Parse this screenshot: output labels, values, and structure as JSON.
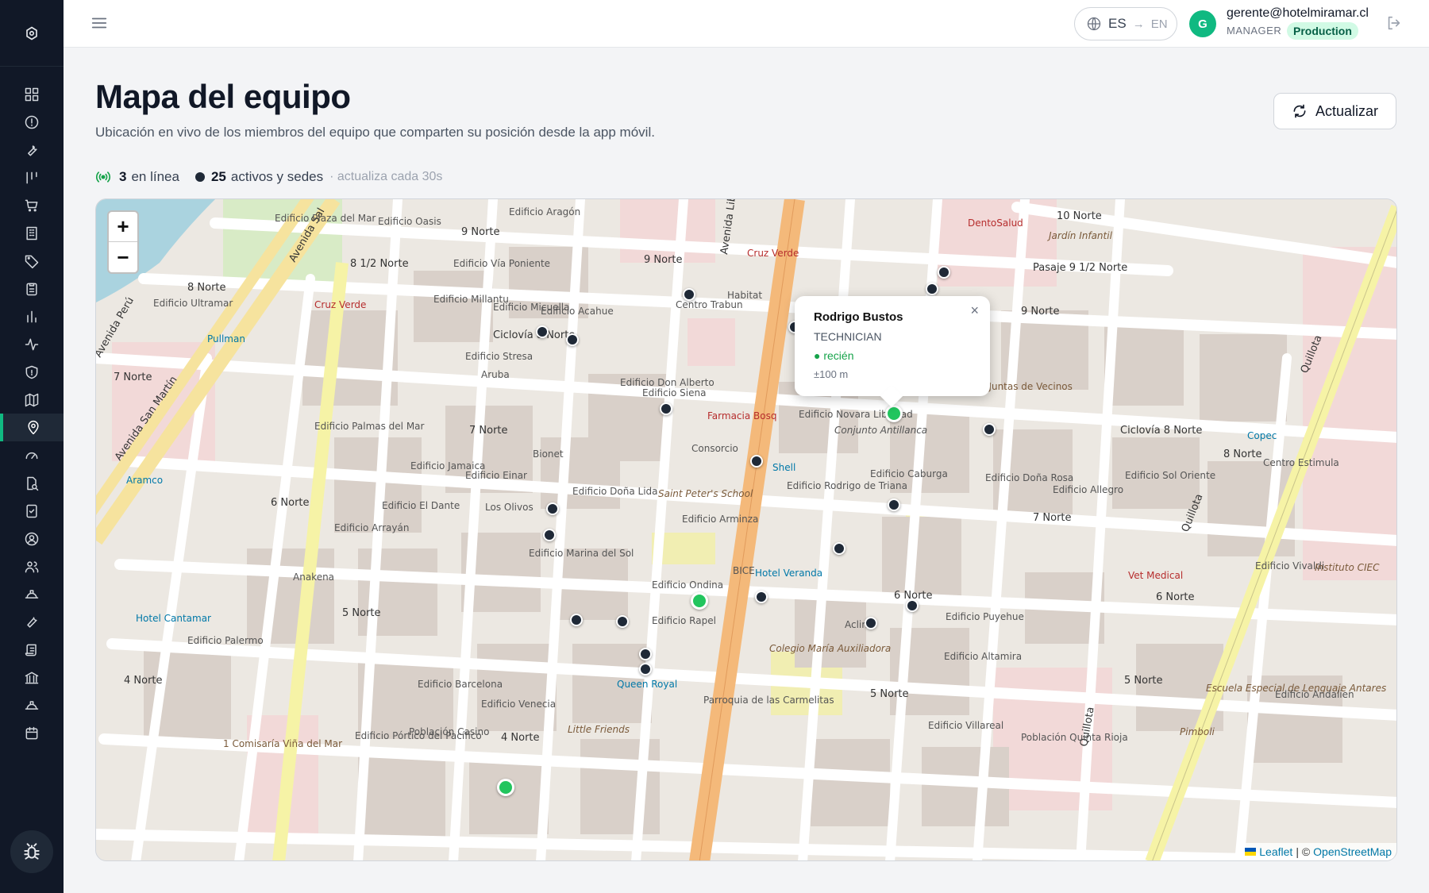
{
  "app": {
    "logo_icon": "gear-logo-icon"
  },
  "sidebar": {
    "items": [
      {
        "icon": "dashboard-icon"
      },
      {
        "icon": "alert-circle-icon"
      },
      {
        "icon": "wrench-icon"
      },
      {
        "icon": "columns-icon"
      },
      {
        "icon": "cart-icon"
      },
      {
        "icon": "building-icon"
      },
      {
        "icon": "tag-icon"
      },
      {
        "icon": "clipboard-icon"
      },
      {
        "icon": "bar-chart-icon"
      },
      {
        "icon": "activity-icon"
      },
      {
        "icon": "shield-icon"
      },
      {
        "icon": "map-icon"
      },
      {
        "icon": "location-pin-icon",
        "active": true
      },
      {
        "icon": "gauge-icon"
      },
      {
        "icon": "file-search-icon"
      },
      {
        "icon": "checklist-icon"
      },
      {
        "icon": "user-circle-icon"
      },
      {
        "icon": "users-icon"
      },
      {
        "icon": "hard-hat-icon"
      },
      {
        "icon": "tool-icon"
      },
      {
        "icon": "scroll-icon"
      },
      {
        "icon": "bank-icon"
      },
      {
        "icon": "helmet-icon"
      },
      {
        "icon": "calendar-icon"
      }
    ],
    "bug_icon": "bug-icon"
  },
  "topbar": {
    "lang_from": "ES",
    "lang_arrow": "→",
    "lang_to": "EN",
    "avatar_initial": "G",
    "user_email": "gerente@hotelmiramar.cl",
    "user_role": "MANAGER",
    "env_badge": "Production"
  },
  "page": {
    "title": "Mapa del equipo",
    "subtitle": "Ubicación en vivo de los miembros del equipo que comparten su posición desde la app móvil.",
    "refresh_label": "Actualizar",
    "stats": {
      "online_count": "3",
      "online_label": "en línea",
      "assets_count": "25",
      "assets_label": "activos y sedes",
      "refresh_note": "· actualiza cada 30s"
    }
  },
  "map": {
    "zoom_in": "+",
    "zoom_out": "−",
    "popup": {
      "name": "Rodrigo Bustos",
      "role": "TECHNICIAN",
      "status": "● recién",
      "accuracy": "±100 m",
      "close": "×"
    },
    "attribution": {
      "leaflet": "Leaflet",
      "separator": "| ©",
      "osm": "OpenStreetMap"
    },
    "labels": {
      "edificio_plaza": "Edificio Plaza del Mar",
      "edificio_oasis": "Edificio Oasis",
      "edificio_aragon": "Edificio Aragón",
      "nueve_norte": "9 Norte",
      "ocho_medio_norte": "8 1/2 Norte",
      "ocho_norte": "8 Norte",
      "edificio_via_poniente": "Edificio Vía Poniente",
      "edificio_ultramar": "Edificio Ultramar",
      "edificio_millantu": "Edificio Millantu",
      "cruz_verde": "Cruz Verde",
      "pullman": "Pullman",
      "siete_norte": "7 Norte",
      "dentosalud": "DentoSalud",
      "jardin_infantil": "Jardín Infantil",
      "diez_norte": "10 Norte",
      "pasaje": "Pasaje 9 1/2 Norte",
      "centro_trabun": "Centro Trabun",
      "habitat": "Habitat",
      "union_comunal": "Unión Comunal de Juntas de Vecinos",
      "edificio_novara": "Edificio Novara Libertad",
      "conjunto_antillanca": "Conjunto Antillanca",
      "farmacia": "Farmacia Bosq",
      "consorcio": "Consorcio",
      "edificio_caburga": "Edificio Caburga",
      "shell": "Shell",
      "edificio_rodrigo_triana": "Edificio Rodrigo de Triana",
      "saint_peters": "Saint Peter's School",
      "edificio_arminza": "Edificio Arminza",
      "hotel_veranda": "Hotel Veranda",
      "bice": "BICE",
      "colegio": "Colegio María Auxiliadora",
      "edificio_puyehue": "Edificio Puyehue",
      "edificio_altamira": "Edificio Altamira",
      "cinco_norte": "5 Norte",
      "seis_norte": "6 Norte",
      "cuatro_norte": "4 Norte",
      "parroquia": "Parroquia de las Carmelitas",
      "queen_royal": "Queen Royal",
      "little_friends": "Little Friends",
      "poblacion_casino": "Población Casino",
      "edificio_portico": "Edificio Pórtico del Pacífico",
      "comisaria": "1 Comisaría Viña del Mar",
      "hotel_cantamar": "Hotel Cantamar",
      "edificio_palermo": "Edificio Palermo",
      "anakena": "Anakena",
      "edificio_arrayan": "Edificio Arrayán",
      "edificio_palmas": "Edificio Palmas del Mar",
      "aramco": "Aramco",
      "edificio_jamaica": "Edificio Jamaica",
      "edificio_einar": "Edificio Einar",
      "edificio_dante": "Edificio El Dante",
      "los_olivos": "Los Olivos",
      "edificio_donalida": "Edificio Doña Lida",
      "edificio_marina": "Edificio Marina del Sol",
      "edificio_ondina": "Edificio Ondina",
      "edificio_rapel": "Edificio Rapel",
      "edificio_barcelona": "Edificio Barcelona",
      "edificio_venecia": "Edificio Venecia",
      "vet_medical": "Vet Medical",
      "edificio_dona_rosa": "Edificio Doña Rosa",
      "edificio_allegro": "Edificio Allegro",
      "edificio_sol_oriente": "Edificio Sol Oriente",
      "centro_estimula": "Centro Estimula",
      "edificio_vivaldi": "Edificio Vivaldi",
      "instituto_ciec": "Instituto CIEC",
      "escuela_especial": "Escuela Especial de Lenguaje Antares",
      "edificio_andalien": "Edificio Andalien",
      "pimboli": "Pimboli",
      "poblacion_quinta": "Población Quinta Rioja",
      "edificio_villareal": "Edificio Villareal",
      "copec": "Copec",
      "quillota": "Quillota",
      "avenida_libertad": "Avenida Libertad",
      "avenida_san_martin": "Avenida San Martín",
      "avenida_peru": "Avenida Perú",
      "avenida_sal": "Avenida Sal",
      "ciclovia": "Ciclovía 8 Norte",
      "bionet": "Bionet",
      "edificio_don_alberto": "Edificio Don Alberto",
      "edificio_siena": "Edificio Siena",
      "edificio_stresa": "Edificio Stresa",
      "aruba": "Aruba",
      "acalin": "Aclin",
      "edificio_micuella": "Edificio Micuella",
      "edificio_acahue": "Edificio Acahue"
    }
  }
}
